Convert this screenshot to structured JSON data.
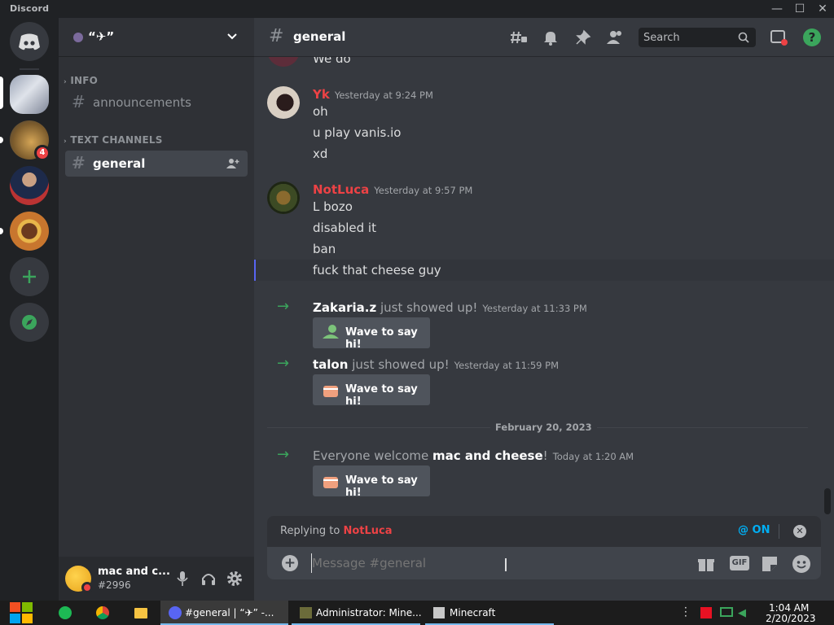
{
  "window": {
    "title": "Discord"
  },
  "server": {
    "name": "“✈”",
    "unread_badge": "4"
  },
  "sidebar": {
    "categories": [
      {
        "label": "INFO",
        "channels": [
          {
            "name": "announcements"
          }
        ]
      },
      {
        "label": "TEXT CHANNELS",
        "channels": [
          {
            "name": "general"
          }
        ]
      }
    ]
  },
  "user": {
    "name": "mac and c...",
    "tag": "#2996"
  },
  "header": {
    "channel": "general",
    "search_placeholder": "Search"
  },
  "messages": {
    "partial": "We do",
    "groups": [
      {
        "author": "Yk",
        "time": "Yesterday at 9:24 PM",
        "author_color": "#ed4245",
        "lines": [
          "oh",
          "u play vanis.io",
          "xd"
        ]
      },
      {
        "author": "NotLuca",
        "time": "Yesterday at 9:57 PM",
        "author_color": "#ed4245",
        "lines": [
          "L bozo",
          "disabled it",
          "ban",
          "fuck that cheese guy"
        ]
      }
    ],
    "joins": [
      {
        "user": "Zakaria.z",
        "text": " just showed up!",
        "time": "Yesterday at 11:33 PM",
        "button": "Wave to say hi!"
      },
      {
        "user": "talon",
        "text": " just showed up!",
        "time": "Yesterday at 11:59 PM",
        "button": "Wave to say hi!"
      }
    ],
    "divider": "February 20, 2023",
    "welcome": {
      "prefix": "Everyone welcome ",
      "user": "mac and cheese",
      "suffix": "!",
      "time": "Today at 1:20 AM",
      "button": "Wave to say hi!"
    }
  },
  "reply": {
    "prefix": "Replying to ",
    "target": "NotLuca",
    "mention": "@ ON"
  },
  "composer": {
    "placeholder": "Message #general",
    "gif": "GIF"
  },
  "taskbar": {
    "apps": [
      {
        "label": "#general | “✈” -..."
      },
      {
        "label": "Administrator: Mine..."
      },
      {
        "label": "Minecraft"
      }
    ],
    "time": "1:04 AM",
    "date": "2/20/2023"
  },
  "colors": {
    "accent": "#5865f2",
    "green": "#3ba55c",
    "red": "#ed4245",
    "bg": "#36393f"
  }
}
